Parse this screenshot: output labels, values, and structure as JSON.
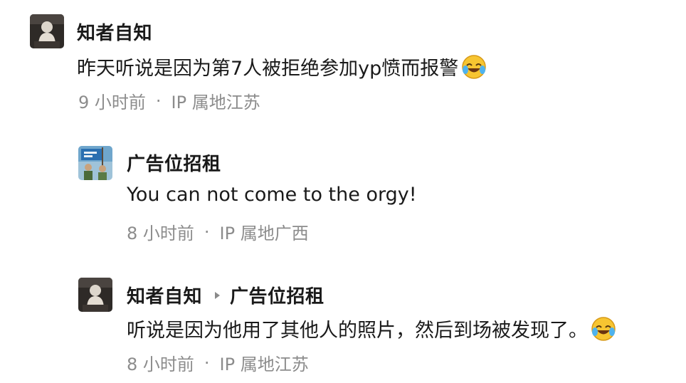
{
  "comments": [
    {
      "author": "知者自知",
      "avatar_icon": "person-figure-avatar",
      "text": "昨天听说是因为第7人被拒绝参加yp愤而报警",
      "emoji_icon": "laughing-crying-emoji",
      "time": "9 小时前",
      "dot": "·",
      "ip": "IP 属地江苏"
    },
    {
      "author": "广告位招租",
      "avatar_icon": "blue-flag-photo-avatar",
      "text": "You can not come to the orgy!",
      "time": "8 小时前",
      "dot": "·",
      "ip": "IP 属地广西"
    },
    {
      "author": "知者自知",
      "reply_to": "广告位招租",
      "avatar_icon": "person-figure-avatar",
      "text": "听说是因为他用了其他人的照片，然后到场被发现了。",
      "emoji_icon": "laughing-crying-emoji",
      "time": "8 小时前",
      "dot": "·",
      "ip": "IP 属地江苏"
    }
  ],
  "colors": {
    "text": "#1a1a1a",
    "meta": "#8c8c8c",
    "emoji": "#f7c531"
  }
}
